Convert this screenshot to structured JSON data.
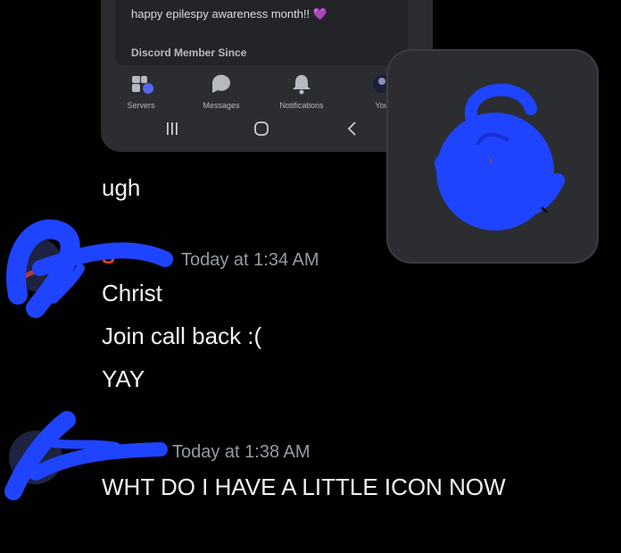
{
  "profile_card": {
    "bio": "happy epilespy awareness month!! ",
    "bio_emoji": "💜",
    "member_since_label": "Discord Member Since"
  },
  "bottom_nav": [
    {
      "label": "Servers",
      "icon": "servers-icon"
    },
    {
      "label": "Messages",
      "icon": "messages-icon"
    },
    {
      "label": "Notifications",
      "icon": "bell-icon"
    },
    {
      "label": "You",
      "icon": "avatar-icon"
    }
  ],
  "system_nav": {
    "recents": "recents-icon",
    "home": "home-icon",
    "back": "back-icon"
  },
  "messages": {
    "standalone": "ugh",
    "group1": {
      "author": "S",
      "timestamp": "Today at 1:34 AM",
      "lines": [
        "Christ",
        "Join call back :(",
        "YAY"
      ]
    },
    "group2": {
      "timestamp": "Today at 1:38 AM",
      "lines": [
        "WHT DO I HAVE A LITTLE ICON NOW"
      ]
    }
  },
  "colors": {
    "background": "#010102",
    "phone_panel": "#2b2d31",
    "card": "#232428",
    "timestamp": "#949ba4",
    "scribble": "#1f44ff",
    "author_name": "#e83c3c",
    "heart": "#b14cf3"
  }
}
